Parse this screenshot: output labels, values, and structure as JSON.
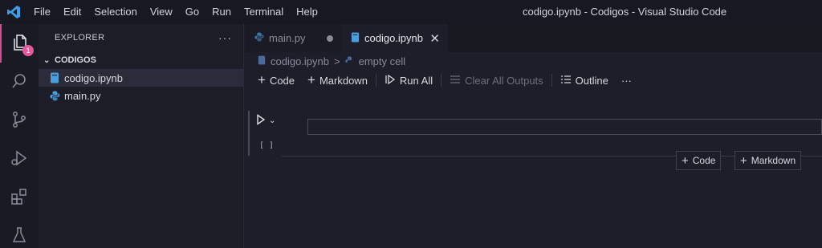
{
  "menu": [
    "File",
    "Edit",
    "Selection",
    "View",
    "Go",
    "Run",
    "Terminal",
    "Help"
  ],
  "window_title": "codigo.ipynb - Codigos - Visual Studio Code",
  "activity": {
    "badge": "1"
  },
  "explorer": {
    "title": "EXPLORER",
    "more": "···",
    "folder": "CODIGOS",
    "files": [
      "codigo.ipynb",
      "main.py"
    ]
  },
  "tabs": [
    {
      "label": "main.py"
    },
    {
      "label": "codigo.ipynb",
      "close": "✕"
    }
  ],
  "breadcrumb": {
    "file": "codigo.ipynb",
    "separator": ">",
    "cell": "empty cell"
  },
  "toolbar": {
    "code": "Code",
    "markdown": "Markdown",
    "run_all": "Run All",
    "clear_outputs": "Clear All Outputs",
    "outline": "Outline",
    "more": "···"
  },
  "cell": {
    "exec_count": "[ ]"
  },
  "add_cell": {
    "code": "Code",
    "markdown": "Markdown"
  },
  "colors": {
    "accent": "#d44d8f",
    "badge": "#e2589a",
    "python_blue": "#4a9ede"
  }
}
